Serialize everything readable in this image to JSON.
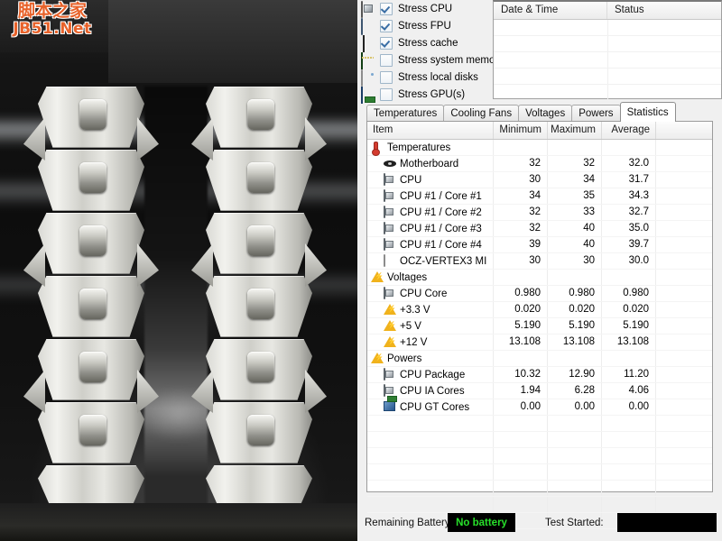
{
  "watermark": {
    "line1": "脚本之家",
    "line2": "JB51.Net"
  },
  "stress_options": [
    {
      "label": "Stress CPU",
      "icon": "cpu-chip-icon",
      "checked": true
    },
    {
      "label": "Stress FPU",
      "icon": "fpu-chip-icon",
      "checked": true
    },
    {
      "label": "Stress cache",
      "icon": "cache-icon",
      "checked": true
    },
    {
      "label": "Stress system memory",
      "icon": "ram-icon",
      "checked": false
    },
    {
      "label": "Stress local disks",
      "icon": "disk-icon",
      "checked": false
    },
    {
      "label": "Stress GPU(s)",
      "icon": "gpu-icon",
      "checked": false
    }
  ],
  "log_table": {
    "columns": [
      "Date & Time",
      "Status"
    ],
    "rows": []
  },
  "tabs": [
    {
      "label": "Temperatures",
      "active": false
    },
    {
      "label": "Cooling Fans",
      "active": false
    },
    {
      "label": "Voltages",
      "active": false
    },
    {
      "label": "Powers",
      "active": false
    },
    {
      "label": "Statistics",
      "active": true
    }
  ],
  "stats_table": {
    "columns": [
      "Item",
      "Minimum",
      "Maximum",
      "Average"
    ],
    "rows": [
      {
        "type": "group",
        "icon": "thermometer-icon",
        "item": "Temperatures",
        "minimum": "",
        "maximum": "",
        "average": ""
      },
      {
        "type": "child",
        "icon": "motherboard-icon",
        "item": "Motherboard",
        "minimum": "32",
        "maximum": "32",
        "average": "32.0"
      },
      {
        "type": "child",
        "icon": "cpu-square-icon",
        "item": "CPU",
        "minimum": "30",
        "maximum": "34",
        "average": "31.7"
      },
      {
        "type": "child",
        "icon": "cpu-square-icon",
        "item": "CPU #1 / Core #1",
        "minimum": "34",
        "maximum": "35",
        "average": "34.3"
      },
      {
        "type": "child",
        "icon": "cpu-square-icon",
        "item": "CPU #1 / Core #2",
        "minimum": "32",
        "maximum": "33",
        "average": "32.7"
      },
      {
        "type": "child",
        "icon": "cpu-square-icon",
        "item": "CPU #1 / Core #3",
        "minimum": "32",
        "maximum": "40",
        "average": "35.0"
      },
      {
        "type": "child",
        "icon": "cpu-square-icon",
        "item": "CPU #1 / Core #4",
        "minimum": "39",
        "maximum": "40",
        "average": "39.7"
      },
      {
        "type": "child",
        "icon": "ssd-icon",
        "item": "OCZ-VERTEX3 MI",
        "minimum": "30",
        "maximum": "30",
        "average": "30.0"
      },
      {
        "type": "group",
        "icon": "warning-icon",
        "item": "Voltages",
        "minimum": "",
        "maximum": "",
        "average": ""
      },
      {
        "type": "child",
        "icon": "cpu-square-icon",
        "item": "CPU Core",
        "minimum": "0.980",
        "maximum": "0.980",
        "average": "0.980"
      },
      {
        "type": "child",
        "icon": "warning-icon",
        "item": "+3.3 V",
        "minimum": "0.020",
        "maximum": "0.020",
        "average": "0.020"
      },
      {
        "type": "child",
        "icon": "warning-icon",
        "item": "+5 V",
        "minimum": "5.190",
        "maximum": "5.190",
        "average": "5.190"
      },
      {
        "type": "child",
        "icon": "warning-icon",
        "item": "+12 V",
        "minimum": "13.108",
        "maximum": "13.108",
        "average": "13.108"
      },
      {
        "type": "group",
        "icon": "warning-icon",
        "item": "Powers",
        "minimum": "",
        "maximum": "",
        "average": ""
      },
      {
        "type": "child",
        "icon": "cpu-square-icon",
        "item": "CPU Package",
        "minimum": "10.32",
        "maximum": "12.90",
        "average": "11.20"
      },
      {
        "type": "child",
        "icon": "cpu-square-icon",
        "item": "CPU IA Cores",
        "minimum": "1.94",
        "maximum": "6.28",
        "average": "4.06"
      },
      {
        "type": "child",
        "icon": "gpu-small-icon",
        "item": "CPU GT Cores",
        "minimum": "0.00",
        "maximum": "0.00",
        "average": "0.00"
      }
    ]
  },
  "status_bar": {
    "battery_label": "Remaining Battery:",
    "battery_value": "No battery",
    "battery_color": "#27e02a",
    "test_started_label": "Test Started:",
    "test_started_value": ""
  },
  "photo": {
    "description": "CPU heatsink coolers behind glass"
  }
}
